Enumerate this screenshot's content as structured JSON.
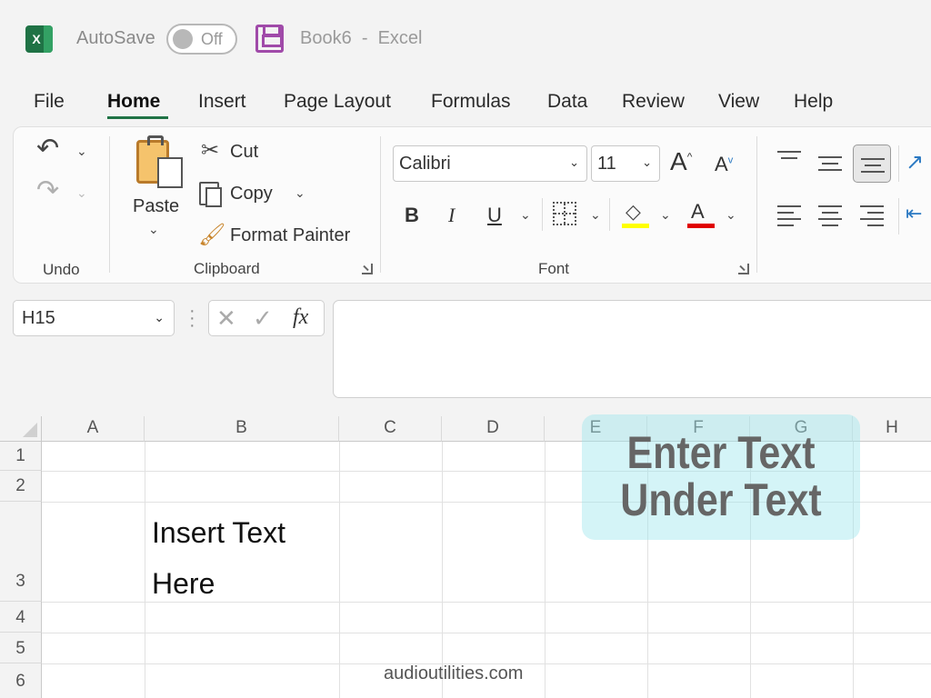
{
  "titlebar": {
    "logo_letter": "X",
    "autosave_label": "AutoSave",
    "autosave_state": "Off",
    "title": "Book6  -  Excel"
  },
  "menu": {
    "tabs": [
      "File",
      "Home",
      "Insert",
      "Page Layout",
      "Formulas",
      "Data",
      "Review",
      "View",
      "Help"
    ],
    "active": "Home"
  },
  "ribbon": {
    "undo_group_label": "Undo",
    "clipboard": {
      "paste_label": "Paste",
      "cut_label": "Cut",
      "copy_label": "Copy",
      "format_painter_label": "Format Painter",
      "group_label": "Clipboard"
    },
    "font": {
      "font_name": "Calibri",
      "font_size": "11",
      "bold": "B",
      "italic": "I",
      "underline": "U",
      "font_color_letter": "A",
      "grow_font": "A",
      "shrink_font": "A",
      "group_label": "Font",
      "fill_color": "#ffff00",
      "text_color": "#e00000"
    }
  },
  "formula_bar": {
    "name_box": "H15",
    "fx_label": "fx",
    "formula": ""
  },
  "sheet": {
    "columns": [
      "A",
      "B",
      "C",
      "D",
      "E",
      "F",
      "G",
      "H"
    ],
    "rows": [
      "1",
      "2",
      "3",
      "4",
      "5",
      "6"
    ],
    "cell_b3_line1": "Insert Text",
    "cell_b3_line2": "Here"
  },
  "annotation": {
    "line1": "Enter Text",
    "line2": "Under Text"
  },
  "watermark": "audioutilities.com",
  "colors": {
    "excel_green": "#1f7245",
    "save_purple": "#a04aa9",
    "overlay_teal": "#a0e6ee"
  }
}
